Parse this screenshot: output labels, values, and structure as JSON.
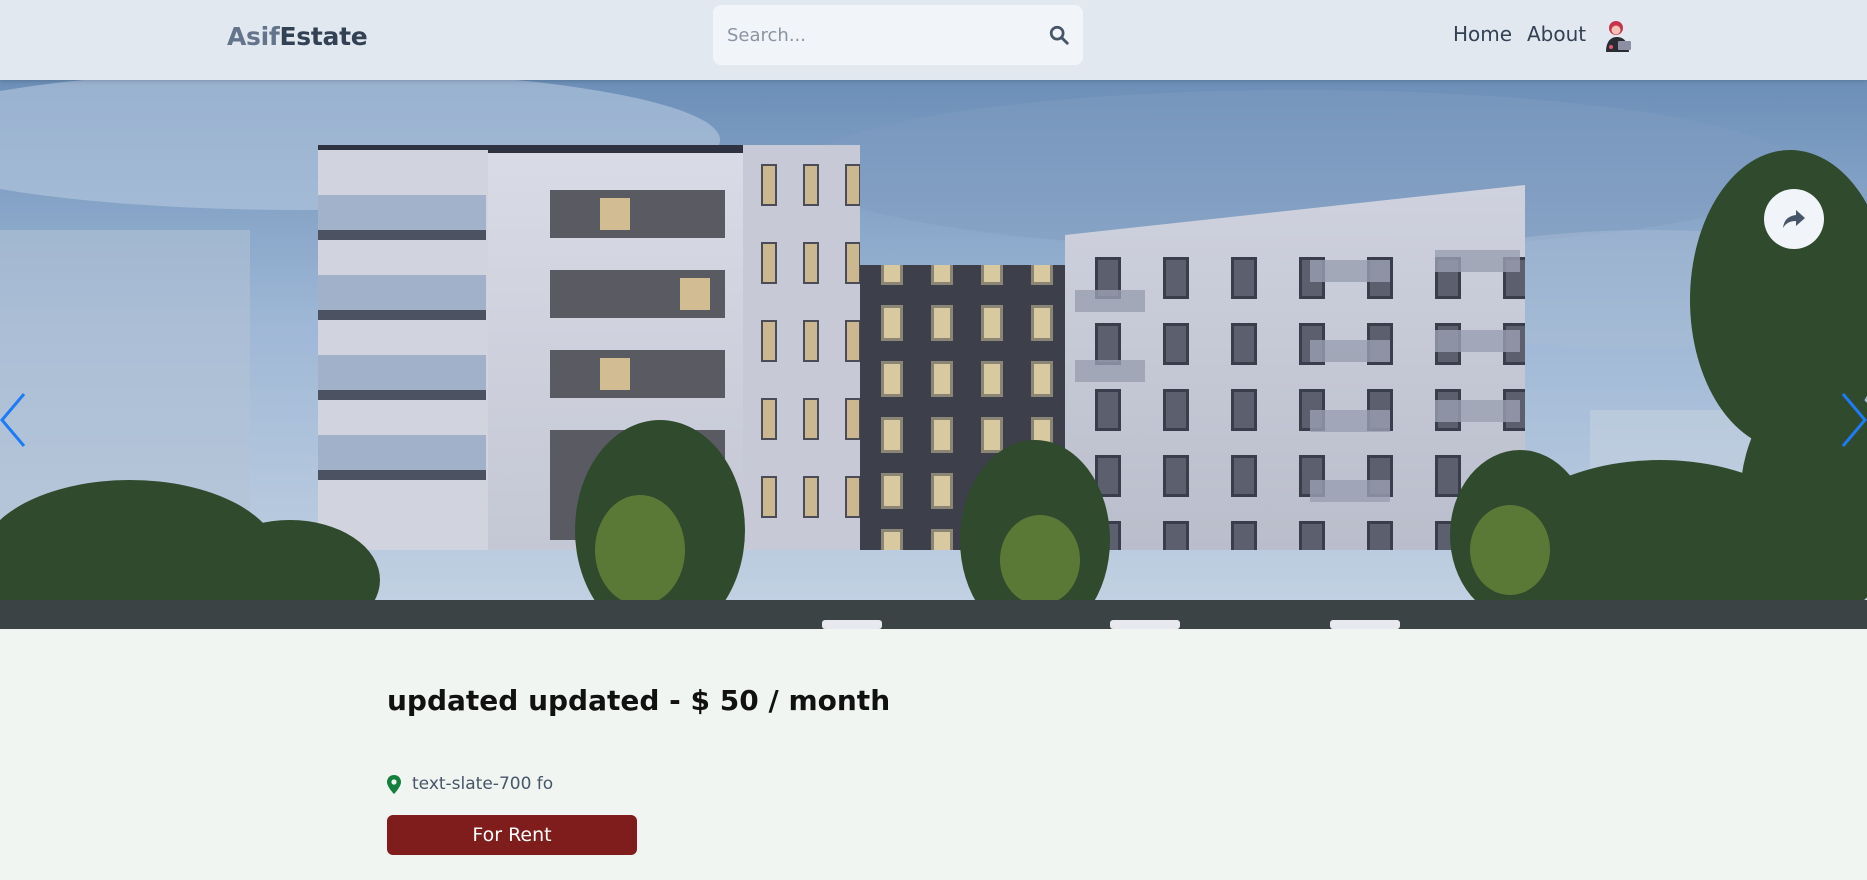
{
  "brand": {
    "part1": "Asif",
    "part2": "Estate"
  },
  "search": {
    "placeholder": "Search...",
    "value": ""
  },
  "nav": {
    "home": "Home",
    "about": "About"
  },
  "listing": {
    "name": "updated updated",
    "price_label": "- $ 50 / month",
    "address": "text-slate-700 fo",
    "type_badge": "For Rent"
  },
  "colors": {
    "header_bg": "#e2e8f0",
    "page_bg": "#f1f5f1",
    "badge_bg": "#7f1d1d",
    "carousel_arrow": "#1d7bf5",
    "pin": "#15803d"
  },
  "icons": {
    "search": "search-icon",
    "share": "share-icon",
    "pin": "map-pin-icon",
    "prev": "chevron-left-icon",
    "next": "chevron-right-icon"
  }
}
